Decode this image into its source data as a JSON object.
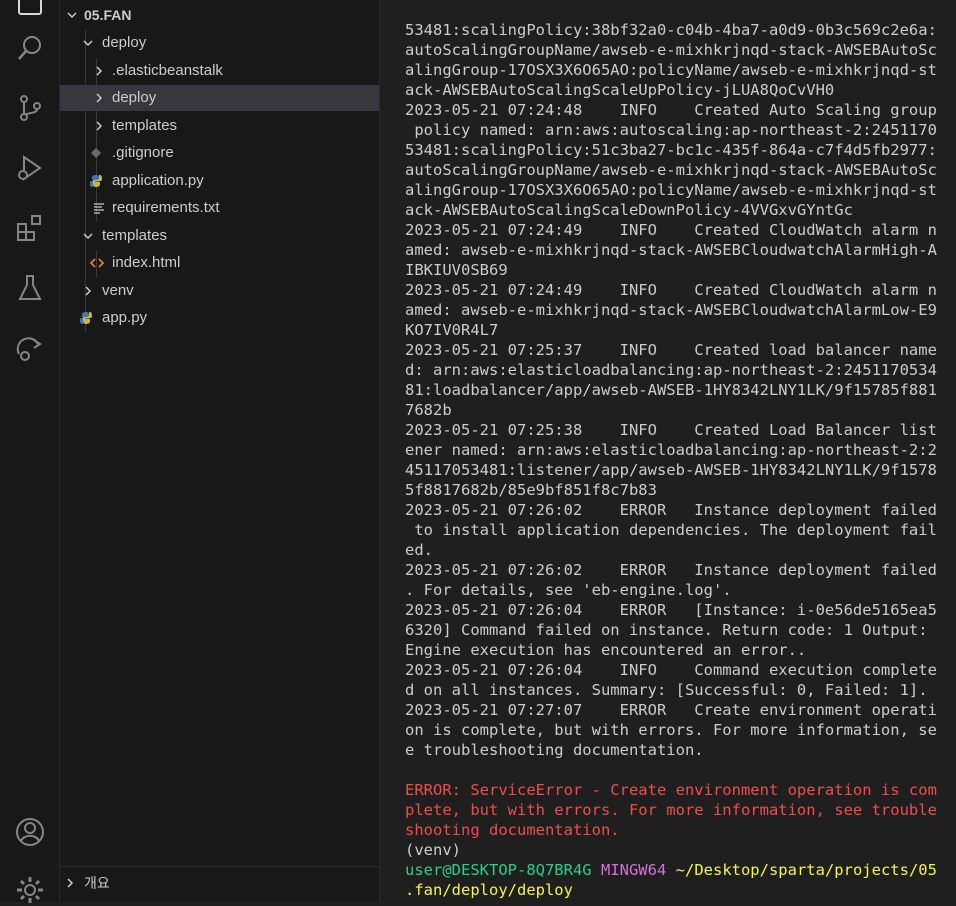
{
  "activity_bar": {
    "icons": [
      "explorer-icon",
      "search-icon",
      "source-control-icon",
      "run-debug-icon",
      "extensions-icon",
      "testing-icon",
      "remote-explorer-icon",
      "accounts-icon",
      "settings-gear-icon"
    ]
  },
  "explorer": {
    "root_label": "05.FAN",
    "items": [
      {
        "label": "deploy",
        "type": "folder",
        "expanded": true
      },
      {
        "label": ".elasticbeanstalk",
        "type": "folder",
        "expanded": false
      },
      {
        "label": "deploy",
        "type": "folder",
        "expanded": false,
        "selected": true
      },
      {
        "label": "templates",
        "type": "folder",
        "expanded": false
      },
      {
        "label": ".gitignore",
        "type": "file",
        "icon": "git-file-icon"
      },
      {
        "label": "application.py",
        "type": "file",
        "icon": "python-file-icon"
      },
      {
        "label": "requirements.txt",
        "type": "file",
        "icon": "text-file-icon"
      },
      {
        "label": "templates",
        "type": "folder",
        "expanded": true
      },
      {
        "label": "index.html",
        "type": "file",
        "icon": "html-file-icon"
      },
      {
        "label": "venv",
        "type": "folder",
        "expanded": false
      },
      {
        "label": "app.py",
        "type": "file",
        "icon": "python-file-icon"
      }
    ],
    "outline_label": "개요"
  },
  "terminal": {
    "lines": [
      {
        "text": "53481:scalingPolicy:38bf32a0-c04b-4ba7-a0d9-0b3c569c2e6a:",
        "kind": "normal"
      },
      {
        "text": "autoScalingGroupName/awseb-e-mixhkrjnqd-stack-AWSEBAutoSc",
        "kind": "normal"
      },
      {
        "text": "alingGroup-17OSX3X6O65AO:policyName/awseb-e-mixhkrjnqd-st",
        "kind": "normal"
      },
      {
        "text": "ack-AWSEBAutoScalingScaleUpPolicy-jLUA8QoCvVH0",
        "kind": "normal"
      },
      {
        "text": "2023-05-21 07:24:48    INFO    Created Auto Scaling group",
        "kind": "normal"
      },
      {
        "text": " policy named: arn:aws:autoscaling:ap-northeast-2:2451170",
        "kind": "normal"
      },
      {
        "text": "53481:scalingPolicy:51c3ba27-bc1c-435f-864a-c7f4d5fb2977:",
        "kind": "normal"
      },
      {
        "text": "autoScalingGroupName/awseb-e-mixhkrjnqd-stack-AWSEBAutoSc",
        "kind": "normal"
      },
      {
        "text": "alingGroup-17OSX3X6O65AO:policyName/awseb-e-mixhkrjnqd-st",
        "kind": "normal"
      },
      {
        "text": "ack-AWSEBAutoScalingScaleDownPolicy-4VVGxvGYntGc",
        "kind": "normal"
      },
      {
        "text": "2023-05-21 07:24:49    INFO    Created CloudWatch alarm n",
        "kind": "normal"
      },
      {
        "text": "amed: awseb-e-mixhkrjnqd-stack-AWSEBCloudwatchAlarmHigh-A",
        "kind": "normal"
      },
      {
        "text": "IBKIUV0SB69",
        "kind": "normal"
      },
      {
        "text": "2023-05-21 07:24:49    INFO    Created CloudWatch alarm n",
        "kind": "normal"
      },
      {
        "text": "amed: awseb-e-mixhkrjnqd-stack-AWSEBCloudwatchAlarmLow-E9",
        "kind": "normal"
      },
      {
        "text": "KO7IV0R4L7",
        "kind": "normal"
      },
      {
        "text": "2023-05-21 07:25:37    INFO    Created load balancer name",
        "kind": "normal"
      },
      {
        "text": "d: arn:aws:elasticloadbalancing:ap-northeast-2:2451170534",
        "kind": "normal"
      },
      {
        "text": "81:loadbalancer/app/awseb-AWSEB-1HY8342LNY1LK/9f15785f881",
        "kind": "normal"
      },
      {
        "text": "7682b",
        "kind": "normal"
      },
      {
        "text": "2023-05-21 07:25:38    INFO    Created Load Balancer list",
        "kind": "normal"
      },
      {
        "text": "ener named: arn:aws:elasticloadbalancing:ap-northeast-2:2",
        "kind": "normal"
      },
      {
        "text": "45117053481:listener/app/awseb-AWSEB-1HY8342LNY1LK/9f1578",
        "kind": "normal"
      },
      {
        "text": "5f8817682b/85e9bf851f8c7b83",
        "kind": "normal"
      },
      {
        "text": "2023-05-21 07:26:02    ERROR   Instance deployment failed",
        "kind": "normal"
      },
      {
        "text": " to install application dependencies. The deployment fail",
        "kind": "normal"
      },
      {
        "text": "ed.",
        "kind": "normal"
      },
      {
        "text": "2023-05-21 07:26:02    ERROR   Instance deployment failed",
        "kind": "normal"
      },
      {
        "text": ". For details, see 'eb-engine.log'.",
        "kind": "normal"
      },
      {
        "text": "2023-05-21 07:26:04    ERROR   [Instance: i-0e56de5165ea5",
        "kind": "normal"
      },
      {
        "text": "6320] Command failed on instance. Return code: 1 Output:",
        "kind": "normal"
      },
      {
        "text": "Engine execution has encountered an error..",
        "kind": "normal"
      },
      {
        "text": "2023-05-21 07:26:04    INFO    Command execution complete",
        "kind": "normal"
      },
      {
        "text": "d on all instances. Summary: [Successful: 0, Failed: 1].",
        "kind": "normal"
      },
      {
        "text": "2023-05-21 07:27:07    ERROR   Create environment operati",
        "kind": "normal"
      },
      {
        "text": "on is complete, but with errors. For more information, se",
        "kind": "normal"
      },
      {
        "text": "e troubleshooting documentation.",
        "kind": "normal"
      },
      {
        "text": "",
        "kind": "normal"
      },
      {
        "text": "ERROR: ServiceError - Create environment operation is com",
        "kind": "error"
      },
      {
        "text": "plete, but with errors. For more information, see trouble",
        "kind": "error"
      },
      {
        "text": "shooting documentation.",
        "kind": "error"
      },
      {
        "text": "(venv)",
        "kind": "normal"
      }
    ],
    "prompt": {
      "user_host": "user@DESKTOP-8Q7BR4G",
      "system": "MINGW64",
      "path_part1": "~/Desktop/sparta/projects/05",
      "path_part2": ".fan/deploy/deploy"
    },
    "colors": {
      "text": "#cccccc",
      "error": "#f14c4c",
      "user_host": "#23d18b",
      "system": "#d670d6",
      "path": "#f5f543"
    }
  }
}
